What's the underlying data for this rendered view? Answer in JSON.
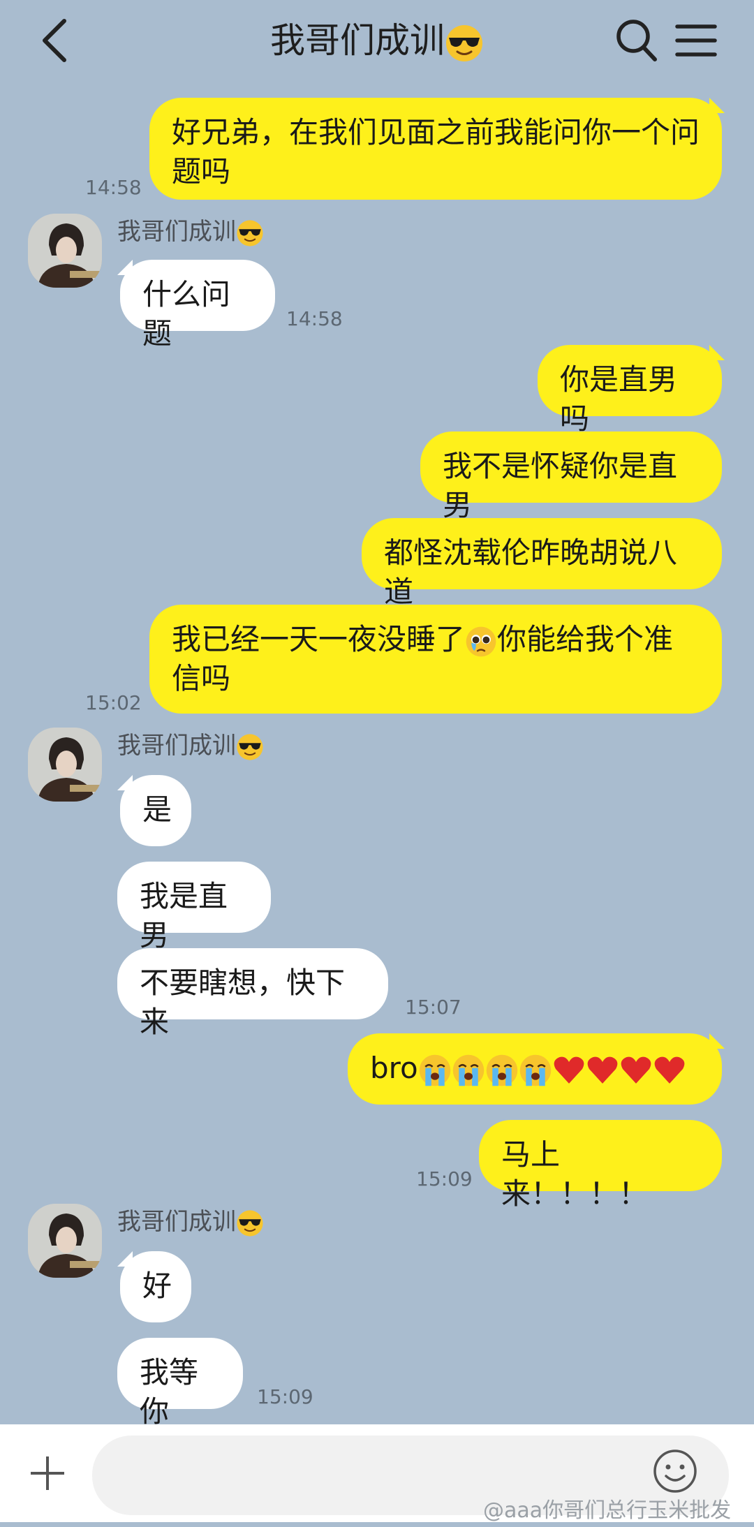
{
  "header": {
    "title": "我哥们成训"
  },
  "contact": {
    "name": "我哥们成训"
  },
  "messages": {
    "m1": "好兄弟，在我们见面之前我能问你一个问",
    "m1b": "题吗",
    "t1": "14:58",
    "m2": "什么问题",
    "t2": "14:58",
    "m3": "你是直男吗",
    "m4": "我不是怀疑你是直男",
    "m5": "都怪沈载伦昨晚胡说八道",
    "m6a": "我已经一天一夜没睡了",
    "m6b": "你能给我个准",
    "m6c": "信吗",
    "t3": "15:02",
    "m7": "是",
    "m8": "我是直男",
    "m9": "不要瞎想，快下来",
    "t4": "15:07",
    "m10": "bro",
    "m11": "马上来！！！！",
    "t5": "15:09",
    "m12": "好",
    "m13": "我等你",
    "t6": "15:09"
  },
  "input": {
    "placeholder": ""
  },
  "watermark": "@aaa你哥们总行玉米批发",
  "colors": {
    "background": "#a9bccf",
    "my_bubble": "#fef01b",
    "their_bubble": "#ffffff"
  },
  "icons": [
    "back-arrow-icon",
    "search-icon",
    "menu-icon",
    "plus-icon",
    "smiley-icon",
    "cool-emoji-icon",
    "sob-emoji-icon",
    "heart-icon",
    "pleading-emoji-icon"
  ]
}
